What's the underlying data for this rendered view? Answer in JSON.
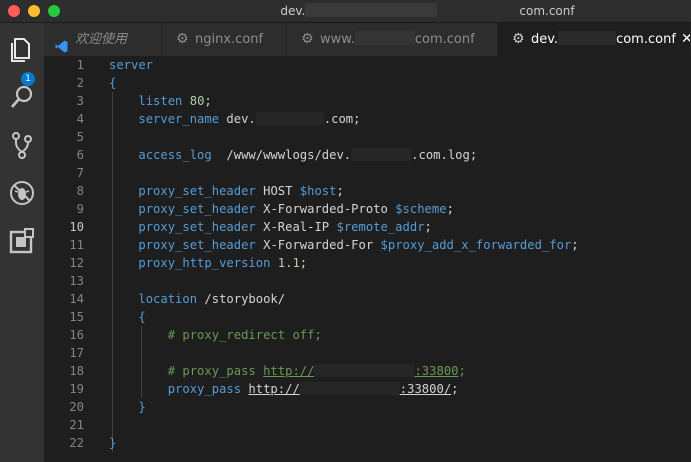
{
  "window": {
    "title_prefix": "dev.",
    "title_suffix": "com.conf"
  },
  "activity_bar": {
    "items": [
      {
        "name": "explorer",
        "icon": "files-icon",
        "badge": "1"
      },
      {
        "name": "search",
        "icon": "search-icon"
      },
      {
        "name": "source-control",
        "icon": "source-control-icon"
      },
      {
        "name": "debug",
        "icon": "debug-icon"
      },
      {
        "name": "extensions",
        "icon": "extensions-icon"
      }
    ]
  },
  "tabs": [
    {
      "label": "欢迎使用",
      "icon": "vscode-logo-icon",
      "active": false
    },
    {
      "label": "nginx.conf",
      "icon": "gear-icon",
      "active": false
    },
    {
      "label_prefix": "www.",
      "label_suffix": "com.conf",
      "icon": "gear-icon",
      "active": false
    },
    {
      "label_prefix": "dev.",
      "label_suffix": "com.conf",
      "icon": "gear-icon",
      "active": true
    }
  ],
  "colors": {
    "keyword": "#569cd6",
    "number": "#b5cea8",
    "comment": "#6a9955",
    "text": "#d4d4d4",
    "background": "#1e1e1e"
  },
  "editor": {
    "current_line": 10,
    "lines": [
      {
        "n": "1",
        "parts": [
          {
            "t": "server",
            "c": "kw"
          }
        ]
      },
      {
        "n": "2",
        "parts": [
          {
            "t": "{",
            "c": "kw"
          }
        ]
      },
      {
        "n": "3",
        "parts": [
          {
            "t": "    "
          },
          {
            "t": "listen",
            "c": "kw"
          },
          {
            "t": " "
          },
          {
            "t": "80",
            "c": "num"
          },
          {
            "t": ";"
          }
        ]
      },
      {
        "n": "4",
        "parts": [
          {
            "t": "    "
          },
          {
            "t": "server_name",
            "c": "kw"
          },
          {
            "t": " dev."
          },
          {
            "r": 68
          },
          {
            "t": ".com;"
          }
        ]
      },
      {
        "n": "5",
        "parts": []
      },
      {
        "n": "6",
        "parts": [
          {
            "t": "    "
          },
          {
            "t": "access_log",
            "c": "kw"
          },
          {
            "t": "  /www/wwwlogs/dev."
          },
          {
            "r": 60
          },
          {
            "t": ".com.log;"
          }
        ]
      },
      {
        "n": "7",
        "parts": []
      },
      {
        "n": "8",
        "parts": [
          {
            "t": "    "
          },
          {
            "t": "proxy_set_header",
            "c": "kw"
          },
          {
            "t": " HOST "
          },
          {
            "t": "$host",
            "c": "var"
          },
          {
            "t": ";"
          }
        ]
      },
      {
        "n": "9",
        "parts": [
          {
            "t": "    "
          },
          {
            "t": "proxy_set_header",
            "c": "kw"
          },
          {
            "t": " X-Forwarded-Proto "
          },
          {
            "t": "$scheme",
            "c": "var"
          },
          {
            "t": ";"
          }
        ]
      },
      {
        "n": "10",
        "parts": [
          {
            "t": "    "
          },
          {
            "t": "proxy_set_header",
            "c": "kw"
          },
          {
            "t": " X-Real-IP "
          },
          {
            "t": "$remote_addr",
            "c": "var"
          },
          {
            "t": ";"
          }
        ]
      },
      {
        "n": "11",
        "parts": [
          {
            "t": "    "
          },
          {
            "t": "proxy_set_header",
            "c": "kw"
          },
          {
            "t": " X-Forwarded-For "
          },
          {
            "t": "$proxy_add_x_forwarded_for",
            "c": "var"
          },
          {
            "t": ";"
          }
        ]
      },
      {
        "n": "12",
        "parts": [
          {
            "t": "    "
          },
          {
            "t": "proxy_http_version",
            "c": "kw"
          },
          {
            "t": " "
          },
          {
            "t": "1.1",
            "c": "num"
          },
          {
            "t": ";"
          }
        ]
      },
      {
        "n": "13",
        "parts": []
      },
      {
        "n": "14",
        "parts": [
          {
            "t": "    "
          },
          {
            "t": "location",
            "c": "kw"
          },
          {
            "t": " /storybook/"
          }
        ]
      },
      {
        "n": "15",
        "parts": [
          {
            "t": "    "
          },
          {
            "t": "{",
            "c": "kw"
          }
        ]
      },
      {
        "n": "16",
        "parts": [
          {
            "t": "        "
          },
          {
            "t": "# proxy_redirect off;",
            "c": "cmt"
          }
        ]
      },
      {
        "n": "17",
        "parts": []
      },
      {
        "n": "18",
        "parts": [
          {
            "t": "        "
          },
          {
            "t": "# proxy_pass ",
            "c": "cmt"
          },
          {
            "t": "http://",
            "c": "cmt url"
          },
          {
            "r": 100
          },
          {
            "t": ":33800",
            "c": "cmt url"
          },
          {
            "t": ";",
            "c": "cmt"
          }
        ]
      },
      {
        "n": "19",
        "parts": [
          {
            "t": "        "
          },
          {
            "t": "proxy_pass",
            "c": "kw"
          },
          {
            "t": " "
          },
          {
            "t": "http://",
            "c": "url"
          },
          {
            "r": 100
          },
          {
            "t": ":33800/",
            "c": "url"
          },
          {
            "t": ";"
          }
        ]
      },
      {
        "n": "20",
        "parts": [
          {
            "t": "    "
          },
          {
            "t": "}",
            "c": "kw"
          }
        ]
      },
      {
        "n": "21",
        "parts": []
      },
      {
        "n": "22",
        "parts": [
          {
            "t": "}",
            "c": "kw"
          }
        ]
      }
    ]
  }
}
